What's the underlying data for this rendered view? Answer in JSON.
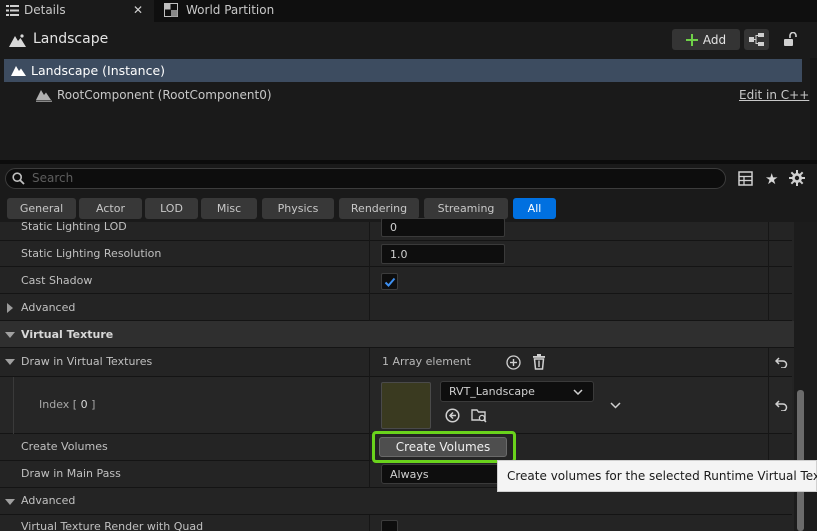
{
  "tabs": [
    {
      "label": "Details",
      "icon": "details-list-icon",
      "active": true
    },
    {
      "label": "World Partition",
      "icon": "world-partition-icon",
      "active": false
    }
  ],
  "header": {
    "title": "Landscape",
    "icon": "landscape-icon",
    "add_label": "Add"
  },
  "components": {
    "selected": "Landscape (Instance)",
    "child": "RootComponent (RootComponent0)",
    "edit_link": "Edit in C++"
  },
  "search": {
    "placeholder": "Search"
  },
  "filters": [
    "General",
    "Actor",
    "LOD",
    "Misc",
    "Physics",
    "Rendering",
    "Streaming",
    "All"
  ],
  "active_filter": "All",
  "properties": {
    "static_lighting_lod": {
      "label": "Static Lighting LOD",
      "value": "0"
    },
    "static_lighting_resolution": {
      "label": "Static Lighting Resolution",
      "value": "1.0"
    },
    "cast_shadow": {
      "label": "Cast Shadow",
      "checked": true
    },
    "advanced1": {
      "label": "Advanced"
    },
    "virtual_texture": {
      "label": "Virtual Texture"
    },
    "draw_in_vt": {
      "label": "Draw in Virtual Textures",
      "value": "1 Array element"
    },
    "index0": {
      "label": "Index",
      "index": "0",
      "asset": "RVT_Landscape"
    },
    "create_volumes": {
      "label": "Create Volumes",
      "button": "Create Volumes"
    },
    "draw_in_main_pass": {
      "label": "Draw in Main Pass",
      "value": "Always"
    },
    "advanced2": {
      "label": "Advanced"
    },
    "vt_render_quad": {
      "label": "Virtual Texture Render with Quad",
      "checked": false
    }
  },
  "tooltip": "Create volumes for the selected Runtime Virtual Textures.",
  "colors": {
    "accent": "#0070e0",
    "selection": "#3d4c60",
    "highlight": "#6ad31c",
    "add_plus": "#6fd148"
  }
}
